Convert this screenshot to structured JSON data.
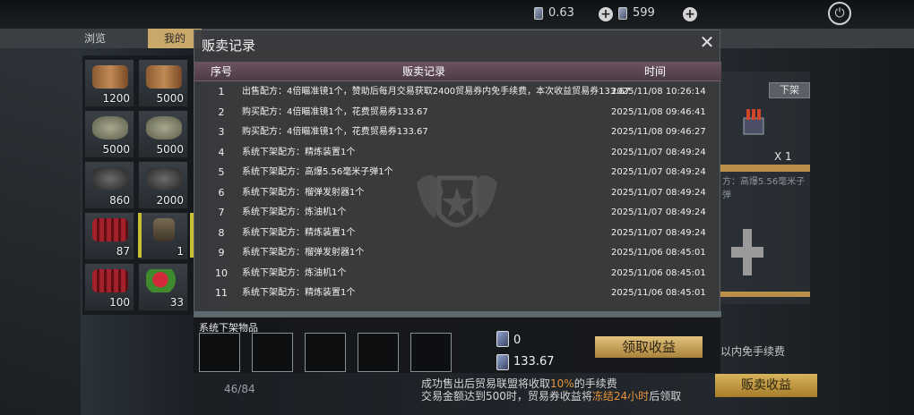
{
  "topbar": {
    "currency1_value": "0.63",
    "currency2_value": "599"
  },
  "bg_tabs": [
    "浏览",
    "我的"
  ],
  "inventory": {
    "counts": [
      "1200",
      "5000",
      "5000",
      "5000",
      "860",
      "2000",
      "87",
      "1",
      "100",
      "33"
    ],
    "page_count": "46/84"
  },
  "right_panel": {
    "delist_label": "下架",
    "quantity": "X 1",
    "item_desc": "方：高爆5.56毫米子弹",
    "free_fee_text": "以内免手续费",
    "sell_income_label": "贩卖收益"
  },
  "fee_notice": {
    "line1_pre": "成功售出后贸易联盟将收取",
    "line1_pct": "10%",
    "line1_post": "的手续费",
    "line2_pre": "交易金额达到500时，贸易券收益将",
    "line2_hl": "冻结24小时",
    "line2_post": "后领取"
  },
  "modal": {
    "title": "贩卖记录",
    "close_label": "✕",
    "columns": {
      "index": "序号",
      "record": "贩卖记录",
      "time": "时间"
    },
    "rows": [
      {
        "idx": "1",
        "record": "出售配方：4倍瞄准镜1个，赞助后每月交易获取2400贸易券内免手续费，本次收益贸易券133.67",
        "time": "2025/11/08 10:26:14"
      },
      {
        "idx": "2",
        "record": "购买配方：4倍瞄准镜1个，花费贸易券133.67",
        "time": "2025/11/08 09:46:41"
      },
      {
        "idx": "3",
        "record": "购买配方：4倍瞄准镜1个，花费贸易券133.67",
        "time": "2025/11/08 09:46:27"
      },
      {
        "idx": "4",
        "record": "系统下架配方：精炼装置1个",
        "time": "2025/11/07 08:49:24"
      },
      {
        "idx": "5",
        "record": "系统下架配方：高爆5.56毫米子弹1个",
        "time": "2025/11/07 08:49:24"
      },
      {
        "idx": "6",
        "record": "系统下架配方：榴弹发射器1个",
        "time": "2025/11/07 08:49:24"
      },
      {
        "idx": "7",
        "record": "系统下架配方：炼油机1个",
        "time": "2025/11/07 08:49:24"
      },
      {
        "idx": "8",
        "record": "系统下架配方：精炼装置1个",
        "time": "2025/11/07 08:49:24"
      },
      {
        "idx": "9",
        "record": "系统下架配方：榴弹发射器1个",
        "time": "2025/11/06 08:45:01"
      },
      {
        "idx": "10",
        "record": "系统下架配方：炼油机1个",
        "time": "2025/11/06 08:45:01"
      },
      {
        "idx": "11",
        "record": "系统下架配方：精炼装置1个",
        "time": "2025/11/06 08:45:01"
      }
    ]
  },
  "delisted": {
    "label": "系统下架物品",
    "ticket1_value": "0",
    "ticket2_value": "133.67",
    "collect_label": "领取收益"
  },
  "colors": {
    "gold_button": "#c9a25a",
    "header_row": "#5c4652",
    "highlight_orange": "#e8953a"
  }
}
